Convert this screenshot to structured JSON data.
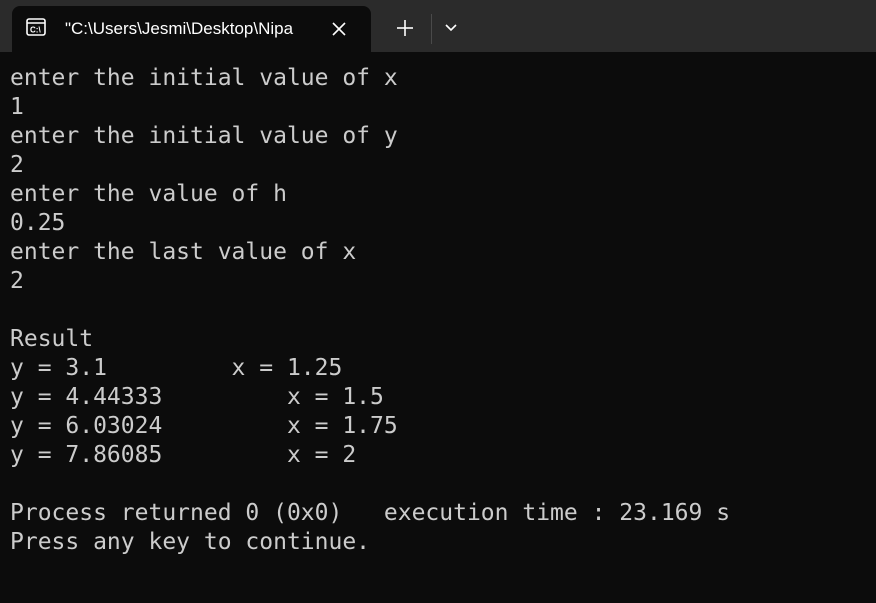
{
  "tab": {
    "icon": "console-icon",
    "title": "\"C:\\Users\\Jesmi\\Desktop\\Nipa"
  },
  "icons": {
    "close": "close-icon",
    "new_tab": "plus-icon",
    "dropdown": "chevron-down-icon"
  },
  "colors": {
    "tabbar_bg": "#2b2b2b",
    "console_bg": "#0c0c0c",
    "console_text": "#cccccc"
  },
  "console": {
    "lines": [
      "enter the initial value of x",
      "1",
      "enter the initial value of y",
      "2",
      "enter the value of h",
      "0.25",
      "enter the last value of x",
      "2",
      "",
      "Result",
      "y = 3.1         x = 1.25",
      "y = 4.44333         x = 1.5",
      "y = 6.03024         x = 1.75",
      "y = 7.86085         x = 2",
      "",
      "Process returned 0 (0x0)   execution time : 23.169 s",
      "Press any key to continue."
    ]
  }
}
